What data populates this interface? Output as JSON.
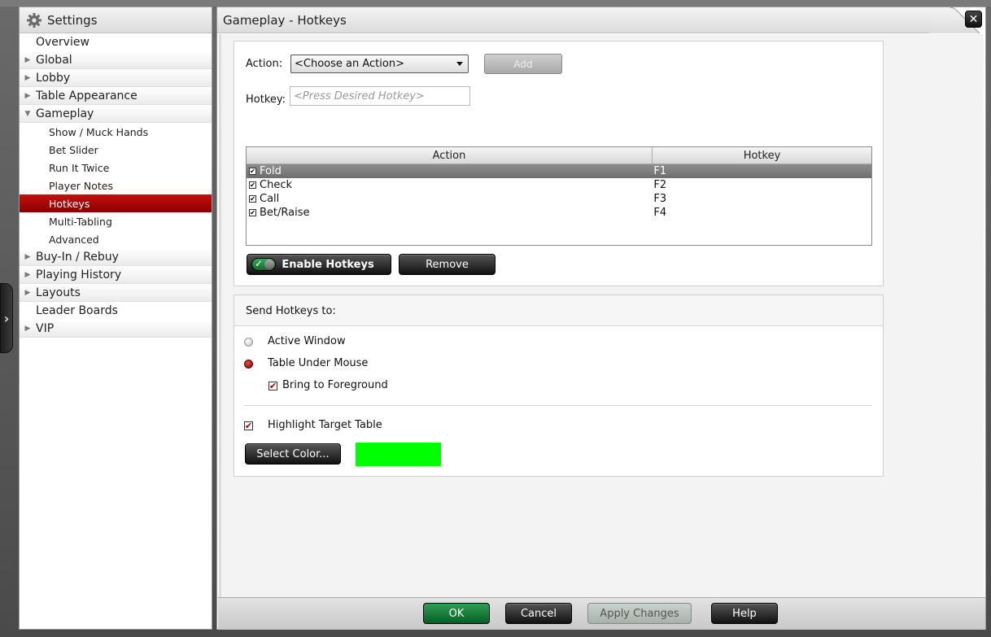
{
  "sidebar": {
    "title": "Settings",
    "items": [
      {
        "label": "Overview",
        "expandable": false
      },
      {
        "label": "Global",
        "expandable": true
      },
      {
        "label": "Lobby",
        "expandable": true
      },
      {
        "label": "Table Appearance",
        "expandable": true
      },
      {
        "label": "Gameplay",
        "expandable": true,
        "expanded": true
      },
      {
        "label": "Buy-In / Rebuy",
        "expandable": true
      },
      {
        "label": "Playing History",
        "expandable": true
      },
      {
        "label": "Layouts",
        "expandable": true
      },
      {
        "label": "Leader Boards",
        "expandable": false
      },
      {
        "label": "VIP",
        "expandable": true
      }
    ],
    "gameplay_subitems": [
      {
        "label": "Show / Muck Hands"
      },
      {
        "label": "Bet Slider"
      },
      {
        "label": "Run It Twice"
      },
      {
        "label": "Player Notes"
      },
      {
        "label": "Hotkeys",
        "active": true
      },
      {
        "label": "Multi-Tabling"
      },
      {
        "label": "Advanced"
      }
    ]
  },
  "header": {
    "title": "Gameplay - Hotkeys",
    "close_glyph": "✕"
  },
  "hotkeys_panel": {
    "action_label": "Action:",
    "action_value": "<Choose an Action>",
    "add_button": "Add",
    "hotkey_label": "Hotkey:",
    "hotkey_placeholder": "<Press Desired Hotkey>",
    "table": {
      "columns": [
        "Action",
        "Hotkey"
      ],
      "rows": [
        {
          "action": "Fold",
          "hotkey": "F1",
          "checked": true,
          "selected": true
        },
        {
          "action": "Check",
          "hotkey": "F2",
          "checked": true
        },
        {
          "action": "Call",
          "hotkey": "F3",
          "checked": true
        },
        {
          "action": "Bet/Raise",
          "hotkey": "F4",
          "checked": true
        }
      ]
    },
    "enable_button": "Enable Hotkeys",
    "enable_state": true,
    "remove_button": "Remove"
  },
  "send_panel": {
    "title": "Send Hotkeys to:",
    "options": [
      {
        "label": "Active Window",
        "selected": false
      },
      {
        "label": "Table Under Mouse",
        "selected": true
      }
    ],
    "bring_to_foreground": {
      "label": "Bring to Foreground",
      "checked": true
    },
    "highlight_target": {
      "label": "Highlight Target Table",
      "checked": true
    },
    "select_color_button": "Select Color...",
    "highlight_color": "#00ff00"
  },
  "footer": {
    "ok": "OK",
    "cancel": "Cancel",
    "apply": "Apply Changes",
    "help": "Help"
  },
  "colors": {
    "accent_red": "#a80000",
    "ok_green": "#1a7f3c"
  }
}
